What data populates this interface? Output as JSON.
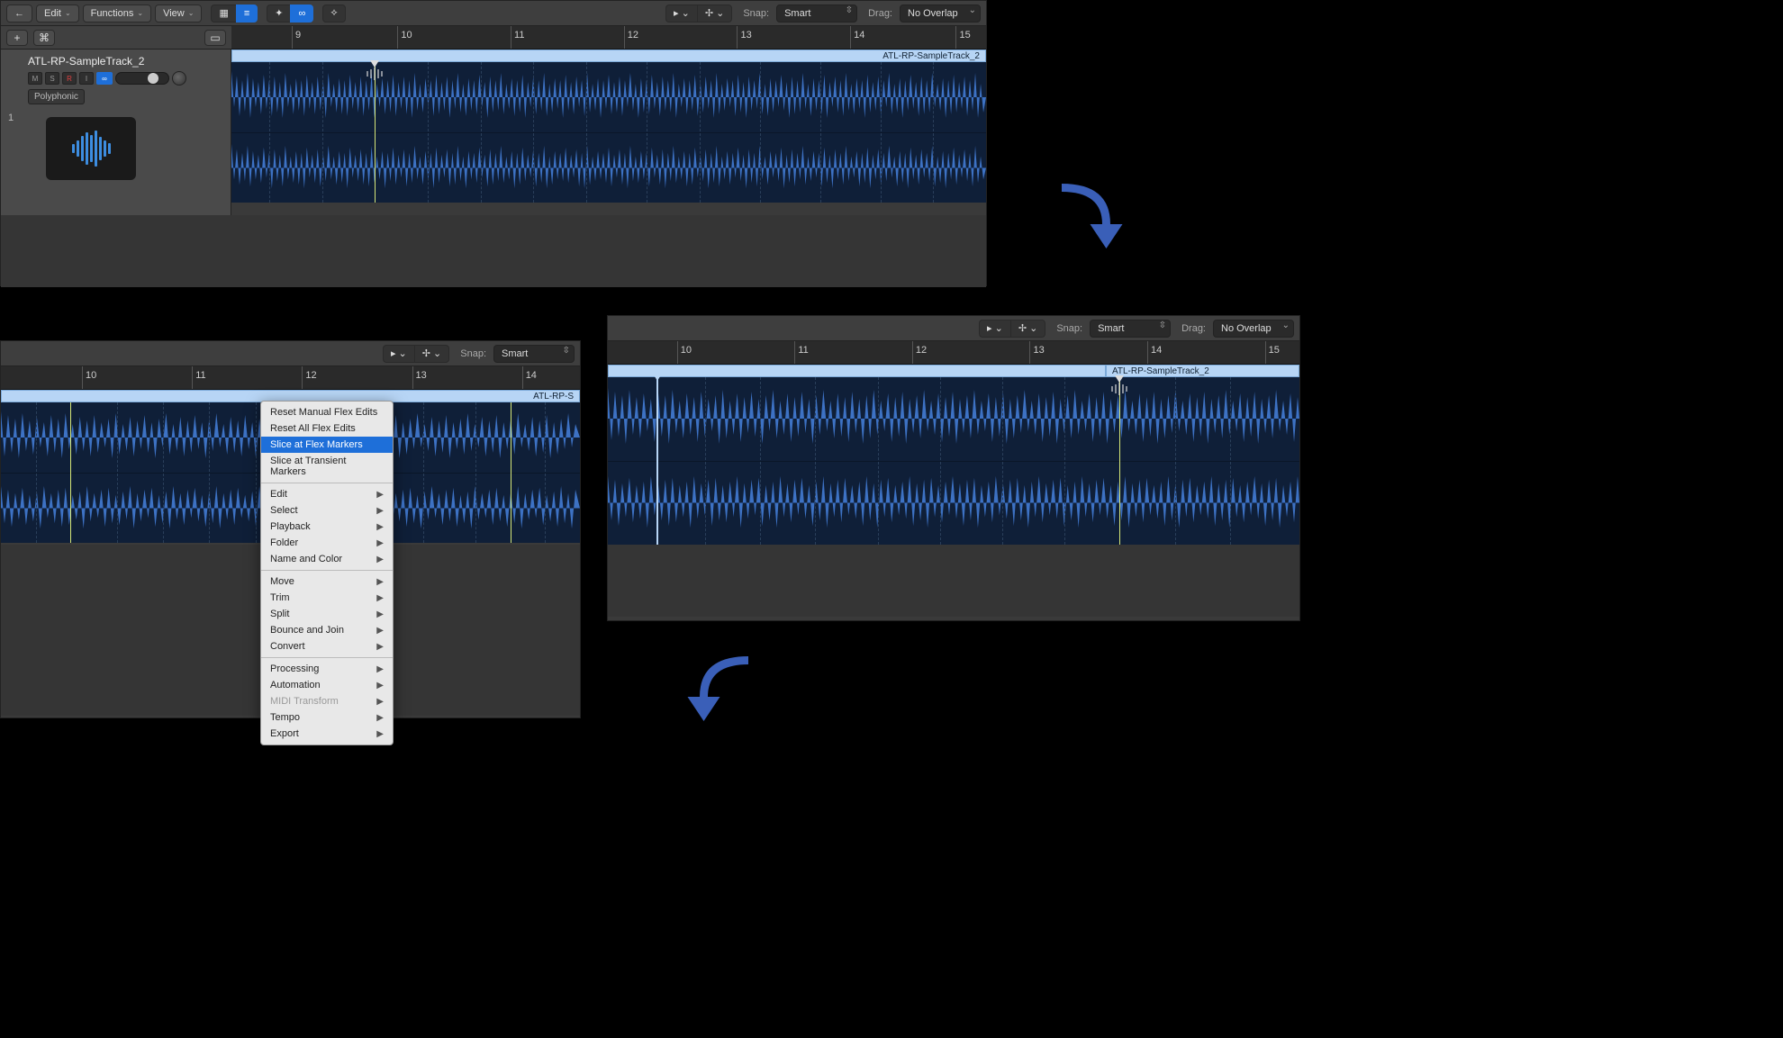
{
  "panel1": {
    "toolbar": {
      "edit": "Edit",
      "functions": "Functions",
      "view": "View",
      "snap_label": "Snap:",
      "snap_value": "Smart",
      "drag_label": "Drag:",
      "drag_value": "No Overlap"
    },
    "track": {
      "index": "1",
      "name": "ATL-RP-SampleTrack_2",
      "mute": "M",
      "solo": "S",
      "rec": "R",
      "input": "I",
      "flex_mode": "Polyphonic"
    },
    "region_name": "ATL-RP-SampleTrack_2",
    "ruler": [
      "9",
      "10",
      "11",
      "12",
      "13",
      "14",
      "15"
    ]
  },
  "panel2": {
    "toolbar": {
      "snap_label": "Snap:",
      "snap_value": "Smart"
    },
    "region_name": "ATL-RP-S",
    "ruler": [
      "10",
      "11",
      "12",
      "13",
      "14"
    ],
    "ctx_menu": {
      "items_a": [
        {
          "label": "Reset Manual Flex Edits",
          "sub": false
        },
        {
          "label": "Reset All Flex Edits",
          "sub": false
        },
        {
          "label": "Slice at Flex Markers",
          "sub": false,
          "hl": true
        },
        {
          "label": "Slice at Transient Markers",
          "sub": false
        }
      ],
      "items_b": [
        {
          "label": "Edit",
          "sub": true
        },
        {
          "label": "Select",
          "sub": true
        },
        {
          "label": "Playback",
          "sub": true
        },
        {
          "label": "Folder",
          "sub": true
        },
        {
          "label": "Name and Color",
          "sub": true
        }
      ],
      "items_c": [
        {
          "label": "Move",
          "sub": true
        },
        {
          "label": "Trim",
          "sub": true
        },
        {
          "label": "Split",
          "sub": true
        },
        {
          "label": "Bounce and Join",
          "sub": true
        },
        {
          "label": "Convert",
          "sub": true
        }
      ],
      "items_d": [
        {
          "label": "Processing",
          "sub": true
        },
        {
          "label": "Automation",
          "sub": true
        },
        {
          "label": "MIDI Transform",
          "sub": true,
          "disabled": true
        },
        {
          "label": "Tempo",
          "sub": true
        },
        {
          "label": "Export",
          "sub": true
        }
      ]
    }
  },
  "panel3": {
    "toolbar": {
      "snap_label": "Snap:",
      "snap_value": "Smart",
      "drag_label": "Drag:",
      "drag_value": "No Overlap"
    },
    "region_name": "ATL-RP-SampleTrack_2",
    "ruler": [
      "10",
      "11",
      "12",
      "13",
      "14",
      "15"
    ]
  }
}
